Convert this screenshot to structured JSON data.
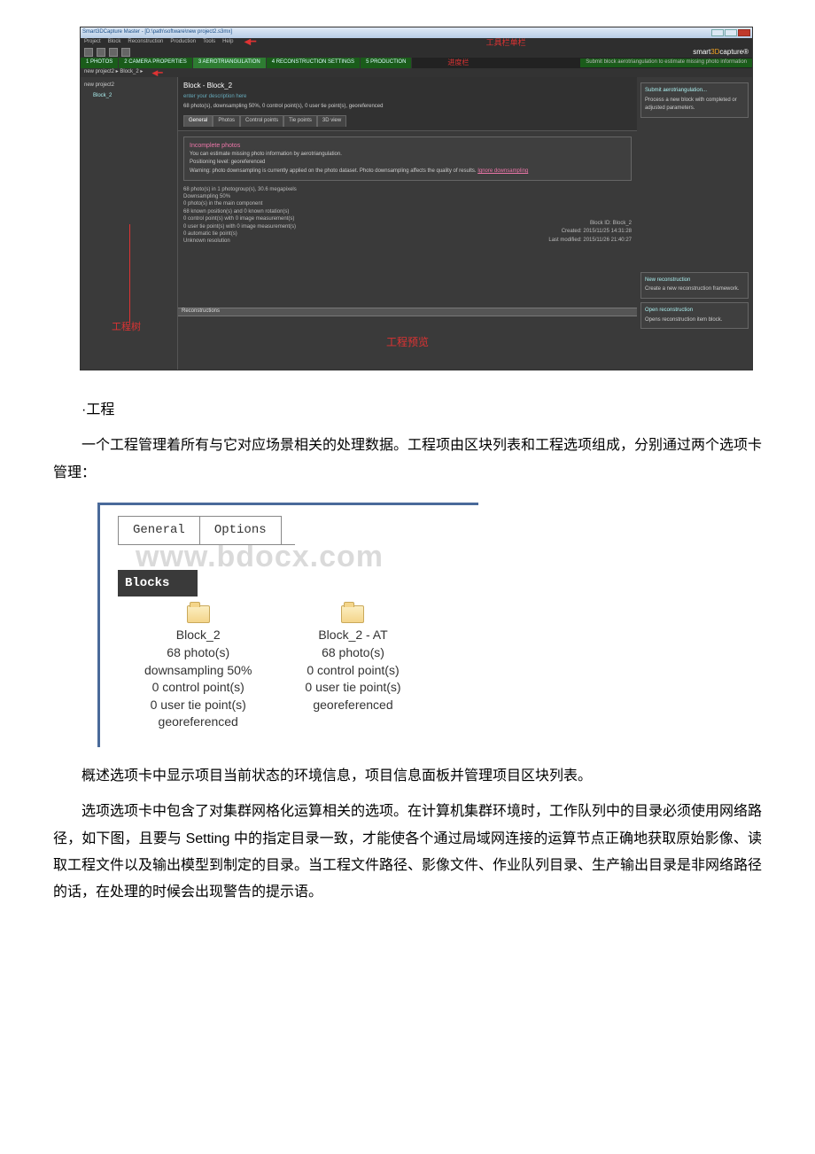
{
  "app": {
    "title": "Smart3DCapture Master - [D:\\path\\software\\new project2.s3mx]",
    "menu": [
      "Project",
      "Block",
      "Reconstruction",
      "Production",
      "Tools",
      "Help"
    ],
    "toolbar_label_zh": "工具栏单栏",
    "brand": {
      "prefix": "smart",
      "mid": "3D",
      "suffix": "capture®"
    },
    "steps": {
      "s1": "1 PHOTOS",
      "s2": "2 CAMERA PROPERTIES",
      "s3": "3 AEROTRIANGULATION",
      "s4": "4 RECONSTRUCTION SETTINGS",
      "s5": "5 PRODUCTION",
      "red_label": "进度栏",
      "hint": "Submit block aerotriangulation to estimate missing photo information"
    },
    "breadcrumb": "new project2  ▸  Block_2  ▸",
    "tree": {
      "root": "new project2",
      "child": "Block_2"
    },
    "tree_label_zh": "工程树",
    "block": {
      "heading": "Block - Block_2",
      "sub": "enter your description here",
      "meta": "68 photo(s), downsampling 50%, 0 control point(s), 0 user tie point(s), georeferenced",
      "tabs": [
        "General",
        "Photos",
        "Control points",
        "Tie points",
        "3D view"
      ],
      "warn_title": "Incomplete photos",
      "warn_l1": "You can estimate missing photo information by aerotriangulation.",
      "warn_l2": "Positioning level: georeferenced",
      "warn_l3_a": "Warning: photo downsampling is currently applied on the photo dataset. Photo downsampling affects the quality of results. ",
      "warn_l3_link": "Ignore downsampling",
      "stats": [
        "68 photo(s) in 1 photogroup(s), 30.6 megapixels",
        "Downsampling 50%",
        "0 photo(s) in the main component",
        "68 known position(s) and 0 known rotation(s)",
        "0 control point(s) with 0 image measurement(s)",
        "0 user tie point(s) with 0 image measurement(s)",
        "0 automatic tie point(s)",
        "Unknown resolution"
      ],
      "id_line": "Block ID: Block_2",
      "created": "Created: 2015/11/25 14:31:28",
      "modified": "Last modified: 2015/11/26 21:40:27",
      "recon_header": "Reconstructions"
    },
    "preview_label_zh": "工程预览",
    "rpanel": {
      "at_title": "Submit aerotriangulation...",
      "at_desc": "Process a new block with completed or adjusted parameters.",
      "nr_title": "New reconstruction",
      "nr_desc": "Create a new reconstruction framework.",
      "op_title": "Open reconstruction",
      "op_desc": "Opens reconstruction item block."
    }
  },
  "doc": {
    "h": "·工程",
    "p1": "一个工程管理着所有与它对应场景相关的处理数据。工程项由区块列表和工程选项组成，分别通过两个选项卡管理：",
    "p2": "概述选项卡中显示项目当前状态的环境信息，项目信息面板并管理项目区块列表。",
    "p3": "选项选项卡中包含了对集群网格化运算相关的选项。在计算机集群环境时，工作队列中的目录必须使用网络路径，如下图，且要与 Setting 中的指定目录一致，才能使各个通过局域网连接的运算节点正确地获取原始影像、读取工程文件以及输出模型到制定的目录。当工程文件路径、影像文件、作业队列目录、生产输出目录是非网络路径的话，在处理的时候会出现警告的提示语。"
  },
  "blocks_fig": {
    "watermark": "www.bdocx.com",
    "tab_general": "General",
    "tab_options": "Options",
    "header": "Blocks",
    "item1": {
      "name": "Block_2",
      "l1": "68 photo(s)",
      "l2": "downsampling 50%",
      "l3": "0 control point(s)",
      "l4": "0 user tie point(s)",
      "l5": "georeferenced"
    },
    "item2": {
      "name": "Block_2 - AT",
      "l1": "68 photo(s)",
      "l2": "0 control point(s)",
      "l3": "0 user tie point(s)",
      "l4": "georeferenced"
    }
  }
}
